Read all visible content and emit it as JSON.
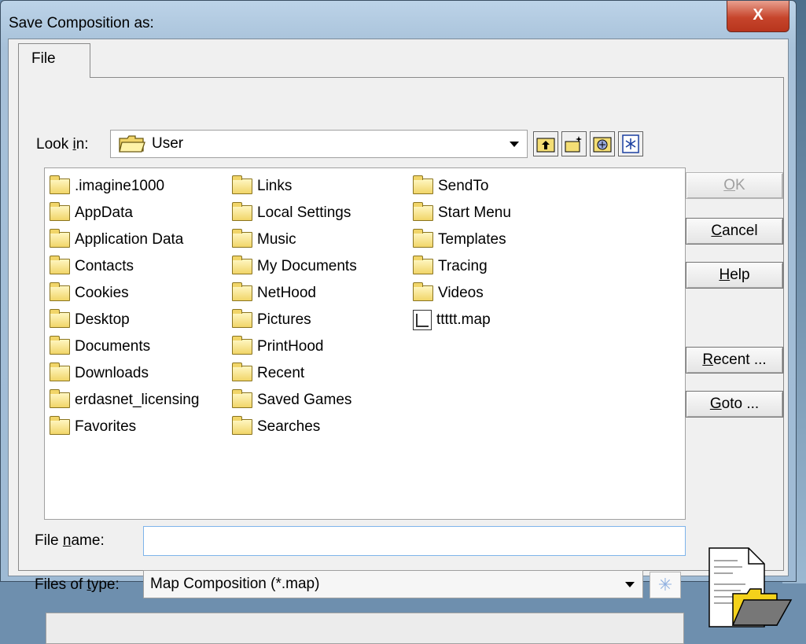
{
  "window": {
    "title": "Save Composition as:",
    "close_label": "X"
  },
  "tab": {
    "label": "File"
  },
  "look_in": {
    "label_pre": "Look ",
    "label_accel": "i",
    "label_post": "n:",
    "value": "User"
  },
  "toolbar": {
    "icons": [
      "up-folder-icon",
      "new-folder-icon",
      "catalog-icon",
      "filter-icon"
    ]
  },
  "files": {
    "col1": [
      ".imagine1000",
      "AppData",
      "Application Data",
      "Contacts",
      "Cookies",
      "Desktop",
      "Documents",
      "Downloads",
      "erdasnet_licensing",
      "Favorites"
    ],
    "col2": [
      "Links",
      "Local Settings",
      "Music",
      "My Documents",
      "NetHood",
      "Pictures",
      "PrintHood",
      "Recent",
      "Saved Games",
      "Searches"
    ],
    "col3": [
      "SendTo",
      "Start Menu",
      "Templates",
      "Tracing",
      "Videos"
    ],
    "map_file": "ttttt.map"
  },
  "buttons": {
    "ok": {
      "accel": "O",
      "rest": "K"
    },
    "cancel": {
      "accel": "C",
      "rest": "ancel"
    },
    "help": {
      "accel": "H",
      "rest": "elp"
    },
    "recent": {
      "accel": "R",
      "rest": "ecent ..."
    },
    "goto": {
      "accel": "G",
      "rest": "oto ..."
    }
  },
  "file_name": {
    "label_pre": "File ",
    "label_accel": "n",
    "label_post": "ame:",
    "value": ""
  },
  "file_type": {
    "label_pre": "Files of ",
    "label_accel": "t",
    "label_post": "ype:",
    "value": "Map Composition (*.map)"
  },
  "colors": {
    "accent": "#7eb4ea",
    "close": "#c6452c",
    "folder": "#f1d569"
  }
}
